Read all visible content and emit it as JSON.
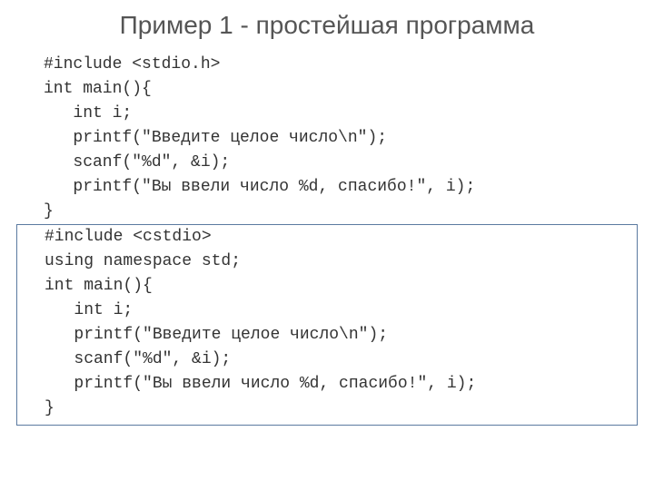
{
  "slide": {
    "title": "Пример 1 - простейшая программа",
    "block1": {
      "l0": "#include <stdio.h>",
      "l1": "int main(){",
      "l2": "   int i;",
      "l3": "   printf(\"Введите целое число\\n\");",
      "l4": "   scanf(\"%d\", &i);",
      "l5": "   printf(\"Вы ввели число %d, спасибо!\", i);",
      "l6": "}"
    },
    "block2": {
      "l0": "#include <cstdio>",
      "l1": "using namespace std;",
      "l2": "int main(){",
      "l3": "   int i;",
      "l4": "   printf(\"Введите целое число\\n\");",
      "l5": "   scanf(\"%d\", &i);",
      "l6": "   printf(\"Вы ввели число %d, спасибо!\", i);",
      "l7": "}"
    }
  }
}
